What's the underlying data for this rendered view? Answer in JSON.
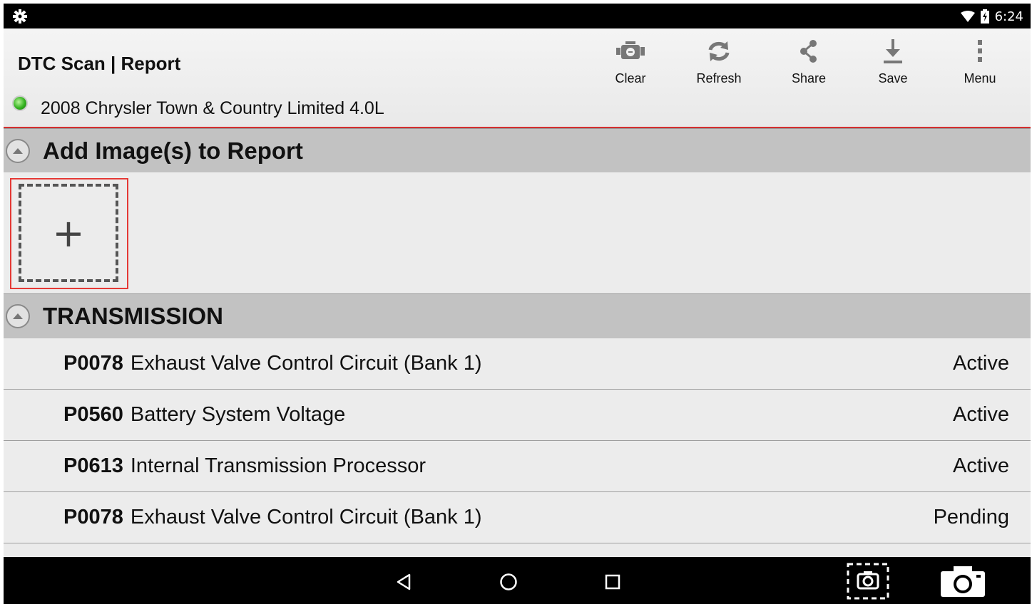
{
  "status_bar": {
    "time": "6:24",
    "icons": [
      "gear-icon",
      "wifi-icon",
      "battery-charging-icon"
    ]
  },
  "header": {
    "title": "DTC Scan | Report",
    "vehicle": "2008 Chrysler Town & Country Limited 4.0L",
    "toolbar": [
      {
        "label": "Clear",
        "icon": "check-engine-icon"
      },
      {
        "label": "Refresh",
        "icon": "refresh-icon"
      },
      {
        "label": "Share",
        "icon": "share-icon"
      },
      {
        "label": "Save",
        "icon": "download-icon"
      },
      {
        "label": "Menu",
        "icon": "overflow-menu-icon"
      }
    ]
  },
  "sections": {
    "images": {
      "title": "Add Image(s) to Report",
      "add_symbol": "+"
    },
    "transmission": {
      "title": "TRANSMISSION",
      "codes": [
        {
          "code": "P0078",
          "description": "Exhaust Valve Control Circuit (Bank 1)",
          "status": "Active"
        },
        {
          "code": "P0560",
          "description": "Battery System Voltage",
          "status": "Active"
        },
        {
          "code": "P0613",
          "description": "Internal Transmission Processor",
          "status": "Active"
        },
        {
          "code": "P0078",
          "description": "Exhaust Valve Control Circuit (Bank 1)",
          "status": "Pending"
        }
      ]
    }
  },
  "navbar": {
    "icons": [
      "back-icon",
      "home-icon",
      "recents-icon",
      "screenshot-icon",
      "camera-icon"
    ]
  },
  "colors": {
    "accent_line": "#d32f2f",
    "section_header": "#c2c2c2",
    "status_led": "#34b320"
  }
}
